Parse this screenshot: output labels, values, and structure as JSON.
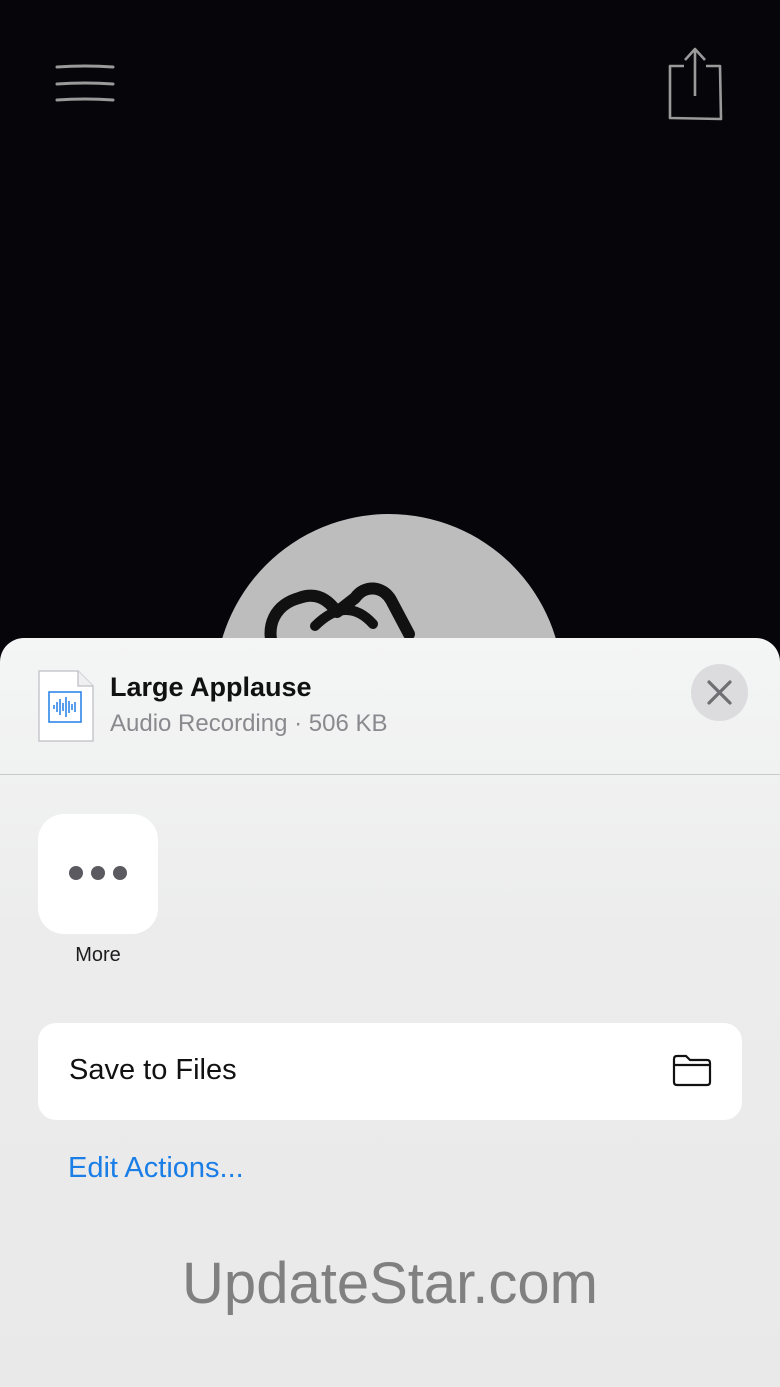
{
  "topbar": {
    "menu_icon": "hamburger-menu-icon",
    "share_icon": "share-icon"
  },
  "background": {
    "artwork_icon": "clapping-hands-icon"
  },
  "share_sheet": {
    "file": {
      "title": "Large Applause",
      "subtitle": "Audio Recording · 506 KB",
      "icon": "audio-file-icon"
    },
    "close_icon": "close-icon",
    "apps": [
      {
        "label": "More",
        "icon": "more-dots-icon"
      }
    ],
    "actions": [
      {
        "label": "Save to Files",
        "icon": "folder-icon"
      }
    ],
    "edit_actions_label": "Edit Actions...",
    "accent_color": "#1a7ee6"
  },
  "watermark": "UpdateStar.com"
}
